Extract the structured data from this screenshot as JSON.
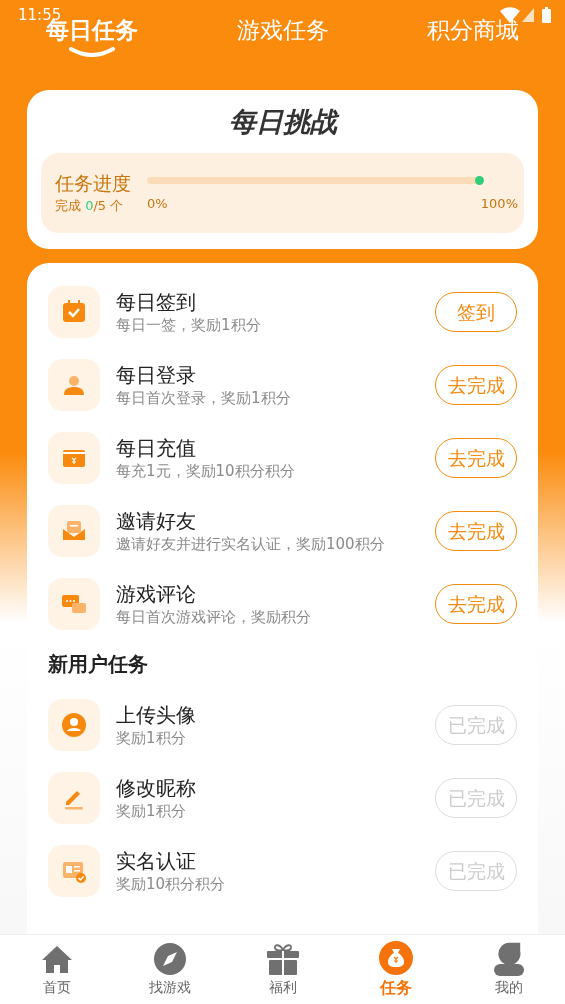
{
  "status_bar": {
    "time": "11:55"
  },
  "tabs": [
    {
      "label": "每日任务",
      "selected": true
    },
    {
      "label": "游戏任务",
      "selected": false
    },
    {
      "label": "积分商城",
      "selected": false
    }
  ],
  "challenge": {
    "title": "每日挑战",
    "progress_label": "任务进度",
    "done_prefix": "完成 ",
    "done_count": "0",
    "done_suffix": "/5 个",
    "level": 0,
    "start_label": "0%",
    "end_label": "100%"
  },
  "daily_tasks": [
    {
      "kind": "calendar",
      "title": "每日签到",
      "desc": "每日一签，奖励1积分",
      "button": "签到",
      "completed": false
    },
    {
      "kind": "person",
      "title": "每日登录",
      "desc": "每日首次登录，奖励1积分",
      "button": "去完成",
      "completed": false
    },
    {
      "kind": "card",
      "title": "每日充值",
      "desc": "每充1元，奖励10积分积分",
      "button": "去完成",
      "completed": false
    },
    {
      "kind": "envelope",
      "title": "邀请好友",
      "desc": "邀请好友并进行实名认证，奖励100积分",
      "button": "去完成",
      "completed": false
    },
    {
      "kind": "chat",
      "title": "游戏评论",
      "desc": "每日首次游戏评论，奖励积分",
      "button": "去完成",
      "completed": false
    }
  ],
  "new_user_section": {
    "title": "新用户任务",
    "tasks": [
      {
        "kind": "avatar",
        "title": "上传头像",
        "desc": "奖励1积分",
        "button": "已完成",
        "completed": true
      },
      {
        "kind": "pencil",
        "title": "修改昵称",
        "desc": "奖励1积分",
        "button": "已完成",
        "completed": true
      },
      {
        "kind": "idcard",
        "title": "实名认证",
        "desc": "奖励10积分积分",
        "button": "已完成",
        "completed": true
      }
    ]
  },
  "bottom_nav": [
    {
      "kind": "home",
      "label": "首页",
      "selected": false
    },
    {
      "kind": "compass",
      "label": "找游戏",
      "selected": false
    },
    {
      "kind": "gift",
      "label": "福利",
      "selected": false
    },
    {
      "kind": "moneybag",
      "label": "任务",
      "selected": true
    },
    {
      "kind": "user",
      "label": "我的",
      "selected": false
    }
  ]
}
